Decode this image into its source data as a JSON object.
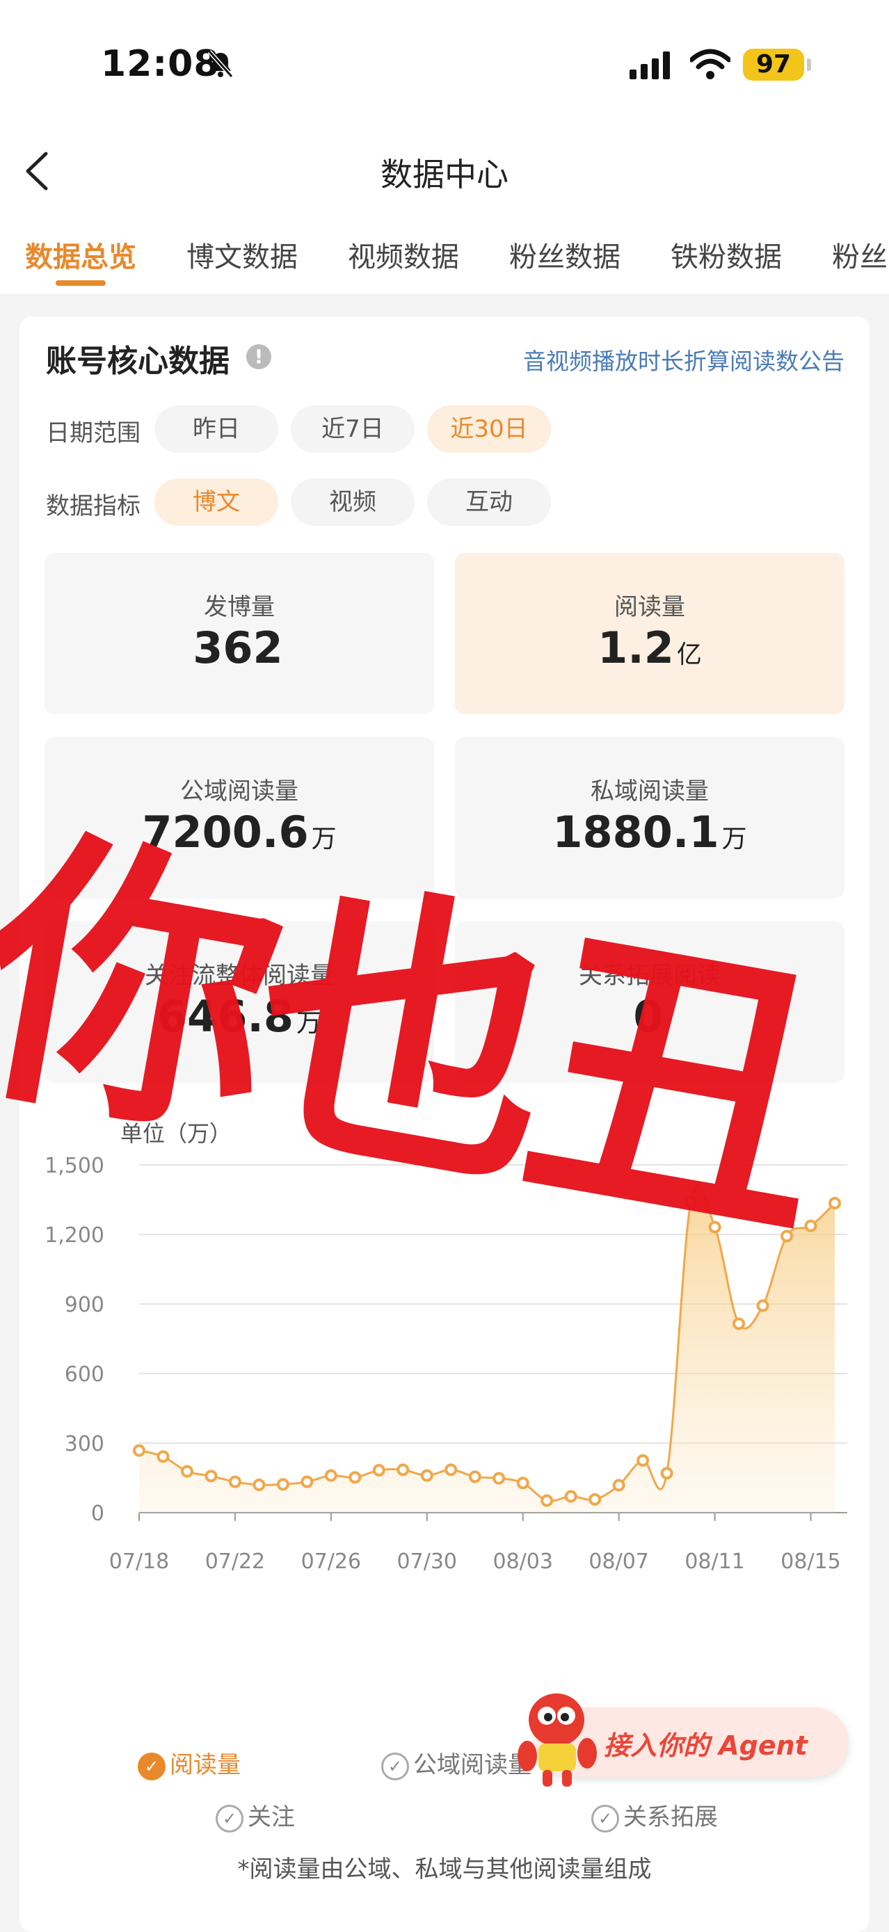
{
  "status_bar": {
    "time": "12:08",
    "battery": "97"
  },
  "nav": {
    "title": "数据中心"
  },
  "tabs": [
    {
      "label": "数据总览",
      "active": true
    },
    {
      "label": "博文数据"
    },
    {
      "label": "视频数据"
    },
    {
      "label": "粉丝数据"
    },
    {
      "label": "铁粉数据"
    },
    {
      "label": "粉丝"
    }
  ],
  "card": {
    "title": "账号核心数据",
    "info_icon": "!",
    "notice_link": "音视频播放时长折算阅读数公告",
    "date_range": {
      "label": "日期范围",
      "options": [
        "昨日",
        "近7日",
        "近30日"
      ],
      "selected": "近30日"
    },
    "metric_type": {
      "label": "数据指标",
      "options": [
        "博文",
        "视频",
        "互动"
      ],
      "selected": "博文"
    }
  },
  "metrics": [
    {
      "label": "发博量",
      "value": "362",
      "unit": ""
    },
    {
      "label": "阅读量",
      "value": "1.2",
      "unit": "亿"
    },
    {
      "label": "公域阅读量",
      "value": "7200.6",
      "unit": "万"
    },
    {
      "label": "私域阅读量",
      "value": "1880.1",
      "unit": "万"
    },
    {
      "label": "关注流整体阅读量",
      "value": "646.8",
      "unit": "万"
    },
    {
      "label": "关系拓展阅读",
      "value": "0",
      "unit": ""
    }
  ],
  "chart_data": {
    "type": "area",
    "ylabel": "单位（万）",
    "ylim": [
      0,
      1500
    ],
    "yticks": [
      "0",
      "300",
      "600",
      "900",
      "1,200",
      "1,500"
    ],
    "x_ticks": [
      "07/18",
      "07/22",
      "07/26",
      "07/30",
      "08/03",
      "08/07",
      "08/11",
      "08/15"
    ],
    "x": [
      "07/18",
      "07/19",
      "07/20",
      "07/21",
      "07/22",
      "07/23",
      "07/24",
      "07/25",
      "07/26",
      "07/27",
      "07/28",
      "07/29",
      "07/30",
      "07/31",
      "08/01",
      "08/02",
      "08/03",
      "08/04",
      "08/05",
      "08/06",
      "08/07",
      "08/08",
      "08/09",
      "08/10",
      "08/11",
      "08/12",
      "08/13",
      "08/14",
      "08/15",
      "08/16"
    ],
    "series": [
      {
        "name": "阅读量",
        "color": "#efa84a",
        "values": [
          268,
          242,
          178,
          158,
          133,
          120,
          122,
          133,
          160,
          152,
          183,
          185,
          160,
          185,
          155,
          148,
          128,
          52,
          70,
          57,
          118,
          225,
          170,
          1340,
          1232,
          815,
          893,
          1193,
          1237,
          1335
        ]
      }
    ],
    "grid": true
  },
  "legend": [
    {
      "label": "阅读量",
      "checked": true
    },
    {
      "label": "公域阅读量",
      "checked": false
    },
    {
      "label": "关注",
      "checked": false
    },
    {
      "label": "关系拓展",
      "checked": false
    }
  ],
  "footnote": "*阅读量由公域、私域与其他阅读量组成",
  "agent_banner": {
    "text": "接入你的 Agent"
  },
  "watermark": {
    "text": "你也丑",
    "color": "#e6121b"
  },
  "icons": {
    "back": "chevron-left-icon",
    "bell": "bell-slash-icon",
    "signal": "signal-icon",
    "wifi": "wifi-icon"
  }
}
